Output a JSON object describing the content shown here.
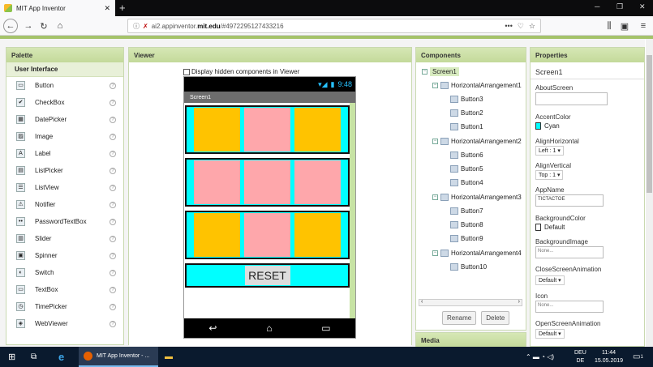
{
  "browser": {
    "tab_title": "MIT App Inventor",
    "url_prefix": "ai2.appinventor.",
    "url_domain": "mit.edu",
    "url_suffix": "/#4972295127433216"
  },
  "palette": {
    "title": "Palette",
    "section": "User Interface",
    "items": [
      "Button",
      "CheckBox",
      "DatePicker",
      "Image",
      "Label",
      "ListPicker",
      "ListView",
      "Notifier",
      "PasswordTextBox",
      "Slider",
      "Spinner",
      "Switch",
      "TextBox",
      "TimePicker",
      "WebViewer"
    ],
    "help_mark": "?"
  },
  "viewer": {
    "title": "Viewer",
    "hidden_label": "Display hidden components in Viewer",
    "time": "9:48",
    "screen_title": "Screen1",
    "reset_label": "RESET"
  },
  "components": {
    "title": "Components",
    "tree": {
      "screen": "Screen1",
      "arrangements": [
        {
          "name": "HorizontalArrangement1",
          "children": [
            "Button3",
            "Button2",
            "Button1"
          ]
        },
        {
          "name": "HorizontalArrangement2",
          "children": [
            "Button6",
            "Button5",
            "Button4"
          ]
        },
        {
          "name": "HorizontalArrangement3",
          "children": [
            "Button7",
            "Button8",
            "Button9"
          ]
        },
        {
          "name": "HorizontalArrangement4",
          "children": [
            "Button10"
          ]
        }
      ]
    },
    "rename": "Rename",
    "delete": "Delete",
    "media": "Media"
  },
  "properties": {
    "title": "Properties",
    "component": "Screen1",
    "about_label": "AboutScreen",
    "accent_label": "AccentColor",
    "accent_value": "Cyan",
    "align_h_label": "AlignHorizontal",
    "align_h_value": "Left : 1 ▾",
    "align_v_label": "AlignVertical",
    "align_v_value": "Top : 1 ▾",
    "appname_label": "AppName",
    "appname_value": "TICTACTOE",
    "bgcolor_label": "BackgroundColor",
    "bgcolor_value": "Default",
    "bgimage_label": "BackgroundImage",
    "bgimage_value": "None...",
    "close_anim_label": "CloseScreenAnimation",
    "close_anim_value": "Default ▾",
    "icon_label": "Icon",
    "icon_value": "None...",
    "open_anim_label": "OpenScreenAnimation",
    "open_anim_value": "Default ▾"
  },
  "taskbar": {
    "app_label": "MIT App Inventor - ...",
    "lang_top": "DEU",
    "lang_bottom": "DE",
    "time": "11:44",
    "date": "15.05.2019",
    "notif_count": "1"
  },
  "colors": {
    "cyan": "#00ffff",
    "gold": "#ffc300",
    "pink": "#fea7ab",
    "green_header": "#c3d99a"
  }
}
